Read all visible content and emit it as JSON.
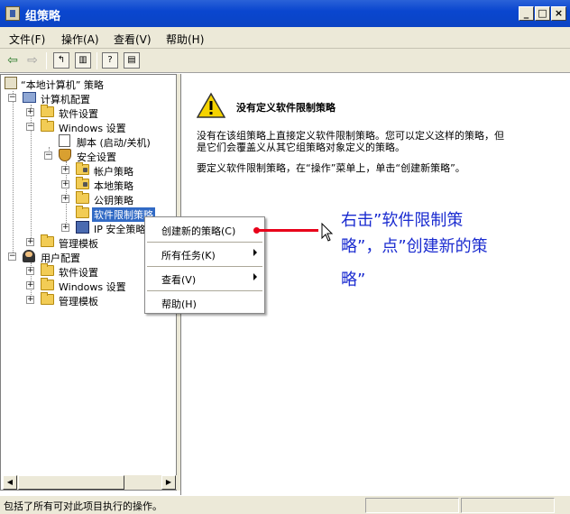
{
  "window": {
    "title": "组策略",
    "controls": {
      "minimize": "_",
      "maximize": "□",
      "close": "×"
    }
  },
  "menubar": {
    "items": [
      {
        "label": "文件(F)"
      },
      {
        "label": "操作(A)"
      },
      {
        "label": "查看(V)"
      },
      {
        "label": "帮助(H)"
      }
    ]
  },
  "toolbar": {
    "icons": [
      "back-arrow-icon",
      "forward-arrow-icon",
      "up-folder-icon",
      "show-hide-tree-icon",
      "help-icon",
      "properties-icon"
    ]
  },
  "tree": {
    "root": "“本地计算机” 策略",
    "computer_config": "计算机配置",
    "software_settings": "软件设置",
    "windows_settings": "Windows 设置",
    "scripts": "脚本 (启动/关机)",
    "security_settings": "安全设置",
    "account_policy": "帐户策略",
    "local_policy": "本地策略",
    "public_key_policy": "公钥策略",
    "software_restriction": "软件限制策略",
    "ip_security": "IP 安全策略",
    "admin_templates": "管理模板",
    "user_config": "用户配置",
    "user_software_settings": "软件设置",
    "user_windows_settings": "Windows 设置",
    "user_admin_templates": "管理模板"
  },
  "detail": {
    "heading": "没有定义软件限制策略",
    "para1_line1": "没有在该组策略上直接定义软件限制策略。您可以定义这样的策略，但",
    "para1_line2": "是它们会覆盖义从其它组策略对象定义的策略。",
    "para2": "要定义软件限制策略，在“操作”菜单上，单击“创建新策略”。"
  },
  "context_menu": {
    "items": [
      {
        "label": "创建新的策略(C)",
        "submenu": false
      },
      {
        "label": "所有任务(K)",
        "submenu": true
      },
      {
        "label": "查看(V)",
        "submenu": true
      },
      {
        "label": "帮助(H)",
        "submenu": false
      }
    ]
  },
  "annotation": {
    "line1": "右击”软件限制策",
    "line2": "略”，点”创建新的策",
    "line3": "略”",
    "color": "#1a2bd0",
    "arrow_color": "#e8001a"
  },
  "statusbar": {
    "text": "包括了所有可对此项目执行的操作。"
  },
  "colors": {
    "titlebar": "#0a46cf",
    "selection": "#316ac5",
    "chrome": "#ece9d8"
  }
}
